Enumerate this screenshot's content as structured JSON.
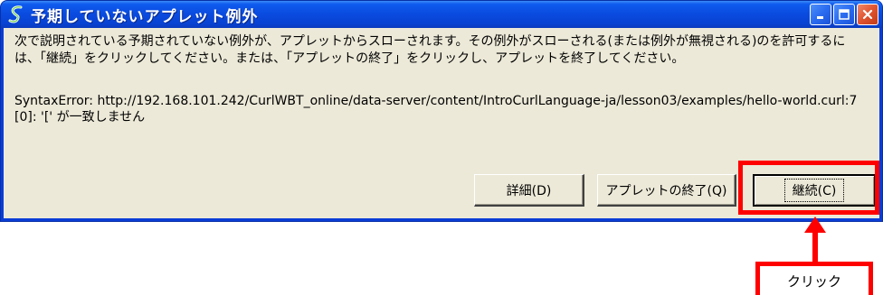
{
  "window": {
    "title": "予期していないアプレット例外",
    "message": "次で説明されている予期されていない例外が、アプレットからスローされます。その例外がスローされる(または例外が無視される)のを許可するには、「継続」をクリックしてください。または、「アプレットの終了」をクリックし、アプレットを終了してください。",
    "error_text": "SyntaxError: http://192.168.101.242/CurlWBT_online/data-server/content/IntroCurlLanguage-ja/lesson03/examples/hello-world.curl:7[0]: '[' が一致しません"
  },
  "buttons": {
    "details_label": "詳細(D)",
    "exit_label": "アプレットの終了(Q)",
    "continue_label": "継続(C)"
  },
  "annotation": {
    "callout_label": "クリック",
    "color": "#ff0000"
  },
  "colors": {
    "titlebar": "#0a4ce0",
    "client_bg": "#ece9d8",
    "close_button": "#e0532f"
  },
  "icons": {
    "app": "curl-s-icon",
    "minimize": "minimize-icon",
    "maximize": "maximize-icon",
    "close": "close-icon"
  }
}
